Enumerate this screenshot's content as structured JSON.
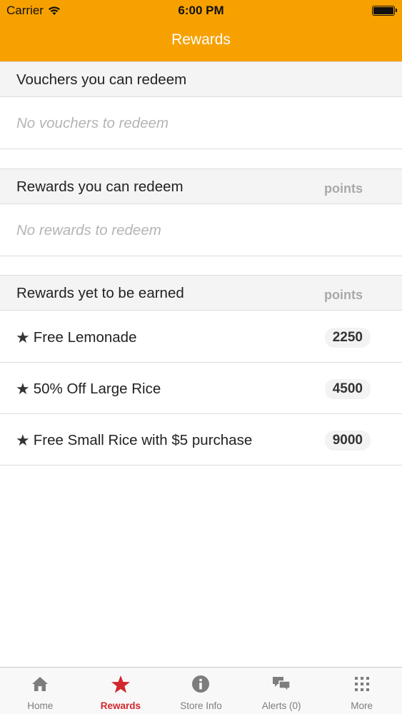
{
  "status_bar": {
    "carrier": "Carrier",
    "time": "6:00 PM"
  },
  "nav": {
    "title": "Rewards"
  },
  "vouchers": {
    "header": "Vouchers you can redeem",
    "empty_text": "No vouchers to redeem"
  },
  "rewards_redeem": {
    "header": "Rewards you can redeem",
    "points_label": "points",
    "empty_text": "No rewards to redeem"
  },
  "rewards_earn": {
    "header": "Rewards yet to be earned",
    "points_label": "points",
    "items": [
      {
        "name": "Free Lemonade",
        "points": "2250"
      },
      {
        "name": "50% Off Large Rice",
        "points": "4500"
      },
      {
        "name": "Free Small Rice with $5 purchase",
        "points": "9000"
      }
    ]
  },
  "tabs": [
    {
      "label": "Home",
      "icon": "home-icon"
    },
    {
      "label": "Rewards",
      "icon": "star-icon",
      "active": true
    },
    {
      "label": "Store Info",
      "icon": "info-icon"
    },
    {
      "label": "Alerts (0)",
      "icon": "chat-bubbles-icon"
    },
    {
      "label": "More",
      "icon": "grid-dots-icon"
    }
  ],
  "colors": {
    "nav_bg": "#f7a100",
    "active_tab": "#d2272d"
  },
  "star_glyph": "★"
}
